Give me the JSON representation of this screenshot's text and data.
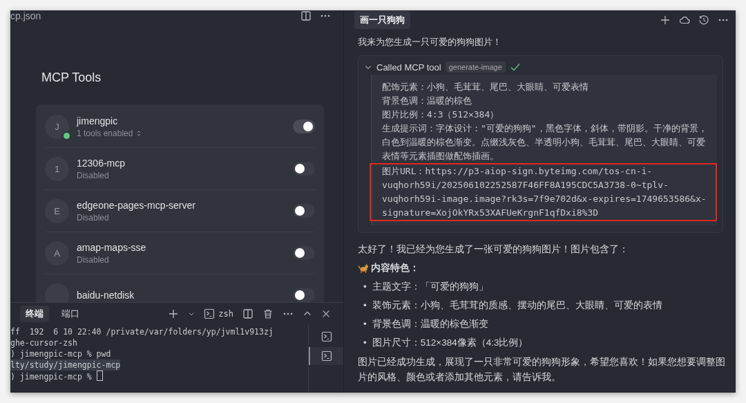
{
  "editor": {
    "tab_title": "cp.json",
    "heading": "MCP Tools",
    "servers": [
      {
        "initial": "J",
        "name": "jimengpic",
        "status": "1 tools enabled",
        "online": true,
        "enabled": true,
        "tools_menu": true
      },
      {
        "initial": "1",
        "name": "12306-mcp",
        "status": "Disabled",
        "online": false,
        "enabled": false,
        "tools_menu": false
      },
      {
        "initial": "E",
        "name": "edgeone-pages-mcp-server",
        "status": "Disabled",
        "online": false,
        "enabled": false,
        "tools_menu": false
      },
      {
        "initial": "A",
        "name": "amap-maps-sse",
        "status": "Disabled",
        "online": false,
        "enabled": false,
        "tools_menu": false
      },
      {
        "name": "baidu-netdisk",
        "online": false,
        "enabled": false,
        "tools_menu": false
      }
    ]
  },
  "terminal": {
    "tabs": [
      {
        "label": "终端",
        "selected": true
      },
      {
        "label": "端口",
        "selected": false
      }
    ],
    "shell": "zsh",
    "lines": [
      {
        "text": "ff  192  6 10 22:40 /private/var/folders/yp/jvml1v913zj",
        "selected": false,
        "cursor": false
      },
      {
        "text": "ghe-cursor-zsh",
        "selected": false,
        "cursor": false
      },
      {
        "text": ") jimengpic-mcp % pwd",
        "selected": false,
        "cursor": false
      },
      {
        "text": "lty/study/jimengpic-mcp",
        "selected": true,
        "cursor": false
      },
      {
        "text": ") jimengpic-mcp % ",
        "selected": false,
        "cursor": true
      }
    ],
    "sessions": [
      {
        "selected": false
      },
      {
        "selected": true
      }
    ]
  },
  "chat": {
    "title": "画一只狗狗",
    "intro": "我来为您生成一只可爱的狗狗图片！",
    "tool_call": {
      "label": "Called MCP tool",
      "tool": "generate-image",
      "expanded": true,
      "success": true,
      "output": [
        {
          "text": "配饰元素：小狗、毛茸茸、尾巴、大眼睛、可爱表情",
          "highlighted": false
        },
        {
          "text": "背景色调：温暖的棕色",
          "highlighted": false
        },
        {
          "text": "图片比例：4:3（512×384）",
          "highlighted": false
        },
        {
          "text": "生成提示词：字体设计：\"可爱的狗狗\"，黑色字体，斜体，带阴影。干净的背景，白色到温暖的棕色渐变。点缀浅灰色、半透明小狗、毛茸茸、尾巴、大眼睛、可爱表情等元素插图做配饰插画。",
          "highlighted": false
        },
        {
          "text": "图片URL：https://p3-aiop-sign.byteimg.com/tos-cn-i-vuqhorh59i/202506102252587F46FF8A195CDC5A3738-0~tplv-vuqhorh59i-image.image?rk3s=7f9e702d&x-expires=1749653586&x-signature=XojOkYRx53XAFUeKrgnF1qfDxi8%3D",
          "highlighted": true
        }
      ]
    },
    "reply": {
      "lead": "太好了！我已经为您生成了一张可爱的狗狗图片！图片包含了：",
      "section_title": "内容特色：",
      "bullets": [
        {
          "marker": "•",
          "text": "主题文字：「可爱的狗狗」"
        },
        {
          "marker": "•",
          "text": "装饰元素：小狗、毛茸茸的质感、摆动的尾巴、大眼睛、可爱的表情"
        },
        {
          "marker": "•",
          "text": "背景色调：温暖的棕色渐变"
        },
        {
          "marker": "•",
          "text": "图片尺寸：512×384像素（4:3比例）"
        }
      ],
      "closing": "图片已经成功生成，展现了一只非常可爱的狗狗形象，希望您喜欢！如果您想要调整图片的风格、颜色或者添加其他元素，请告诉我。"
    }
  }
}
